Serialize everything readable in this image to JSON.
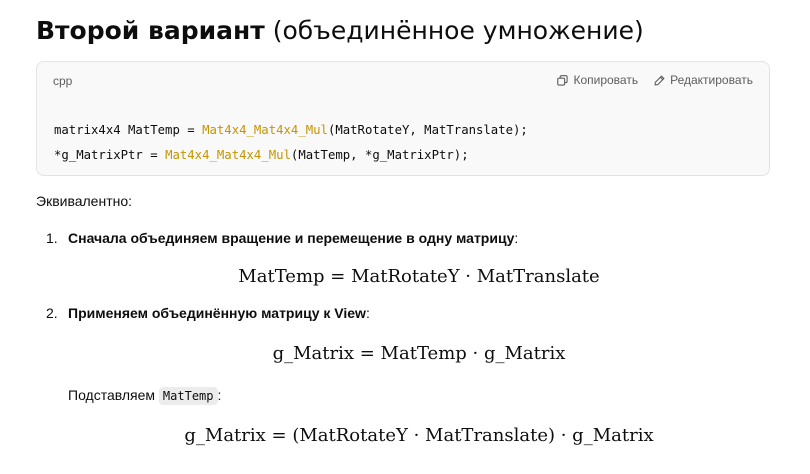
{
  "heading": {
    "bold": "Второй вариант",
    "normal": "(объединённое умножение)"
  },
  "code_block": {
    "language": "cpp",
    "copy_label": "Копировать",
    "edit_label": "Редактировать",
    "line1": {
      "pre": "matrix4x4 MatTemp = ",
      "fn": "Mat4x4_Mat4x4_Mul",
      "post": "(MatRotateY, MatTranslate);"
    },
    "line2": {
      "pre": "*g_MatrixPtr = ",
      "fn": "Mat4x4_Mat4x4_Mul",
      "post": "(MatTemp, *g_MatrixPtr);"
    }
  },
  "equivalent_label": "Эквивалентно:",
  "steps": [
    {
      "number": "1.",
      "bold": "Сначала объединяем вращение и перемещение в одну матрицу",
      "suffix": ":",
      "formula": "MatTemp = MatRotateY · MatTranslate"
    },
    {
      "number": "2.",
      "bold": "Применяем объединённую матрицу к View",
      "suffix": ":",
      "formula": "g_Matrix = MatTemp · g_Matrix"
    }
  ],
  "substitute": {
    "prefix": "Подставляем",
    "code": "MatTemp",
    "suffix": ":",
    "formula": "g_Matrix = (MatRotateY · MatTranslate) · g_Matrix"
  }
}
